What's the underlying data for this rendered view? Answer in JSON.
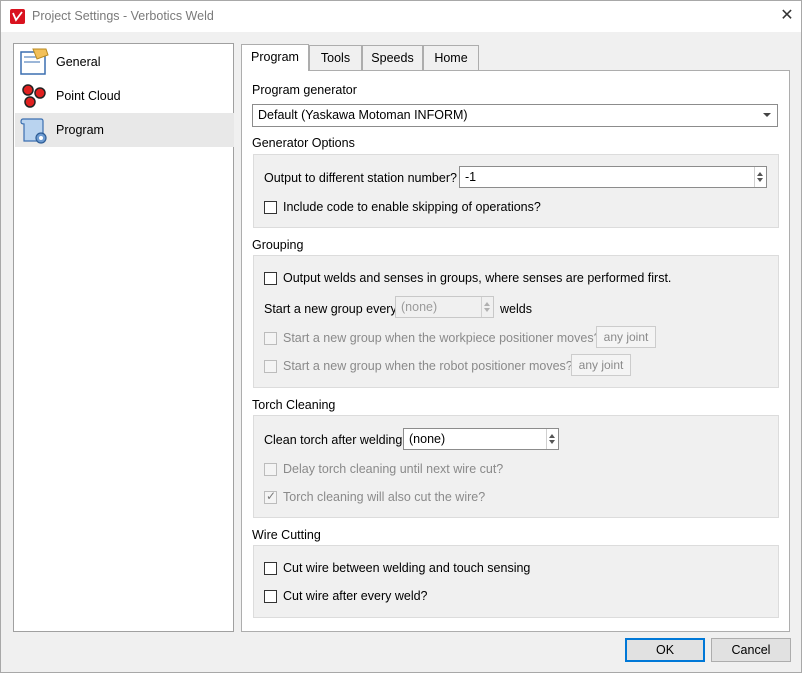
{
  "window": {
    "title": "Project Settings - Verbotics Weld",
    "close_icon": "close-icon"
  },
  "sidebar": {
    "items": [
      {
        "label": "General",
        "icon": "hand-form-icon",
        "selected": false
      },
      {
        "label": "Point Cloud",
        "icon": "red-dots-icon",
        "selected": false
      },
      {
        "label": "Program",
        "icon": "scroll-gear-icon",
        "selected": true
      }
    ]
  },
  "tabs": [
    {
      "label": "Program",
      "active": true
    },
    {
      "label": "Tools",
      "active": false
    },
    {
      "label": "Speeds",
      "active": false
    },
    {
      "label": "Home",
      "active": false
    }
  ],
  "program_generator": {
    "label": "Program generator",
    "value": "Default (Yaskawa Motoman INFORM)"
  },
  "generator_options": {
    "title": "Generator Options",
    "station_label": "Output to different station number?",
    "station_value": "-1",
    "skip_label": "Include code to enable skipping of operations?",
    "skip_checked": false
  },
  "grouping": {
    "title": "Grouping",
    "output_groups_label": "Output welds and senses in groups, where senses are performed first.",
    "output_groups_checked": false,
    "new_group_label": "Start a new group every",
    "new_group_value": "(none)",
    "new_group_unit": "welds",
    "workpiece_label": "Start a new group when the workpiece positioner moves?",
    "workpiece_btn": "any joint",
    "robot_label": "Start a new group when the robot positioner moves?",
    "robot_btn": "any joint"
  },
  "torch_cleaning": {
    "title": "Torch Cleaning",
    "clean_label": "Clean torch after welding",
    "clean_value": "(none)",
    "delay_label": "Delay torch cleaning until next wire cut?",
    "delay_checked": false,
    "cut_label": "Torch cleaning will also cut the wire?",
    "cut_checked": true
  },
  "wire_cutting": {
    "title": "Wire Cutting",
    "between_label": "Cut wire between welding and touch sensing",
    "between_checked": false,
    "every_label": "Cut wire after every weld?",
    "every_checked": false
  },
  "buttons": {
    "ok": "OK",
    "cancel": "Cancel"
  },
  "colors": {
    "accent": "#0078d7",
    "brand": "#d9121f"
  }
}
